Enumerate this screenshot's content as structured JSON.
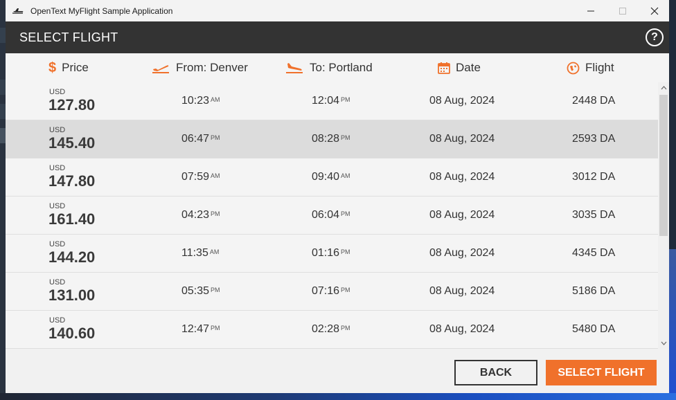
{
  "window": {
    "title": "OpenText MyFlight Sample Application"
  },
  "header": {
    "title": "SELECT FLIGHT",
    "help": "?"
  },
  "columns": {
    "price": "Price",
    "from": "From: Denver",
    "to": "To: Portland",
    "date": "Date",
    "flight": "Flight"
  },
  "flights": [
    {
      "currency": "USD",
      "price": "127.80",
      "dep_time": "10:23",
      "dep_ampm": "AM",
      "arr_time": "12:04",
      "arr_ampm": "PM",
      "date": "08 Aug, 2024",
      "flight": "2448 DA"
    },
    {
      "currency": "USD",
      "price": "145.40",
      "dep_time": "06:47",
      "dep_ampm": "PM",
      "arr_time": "08:28",
      "arr_ampm": "PM",
      "date": "08 Aug, 2024",
      "flight": "2593 DA"
    },
    {
      "currency": "USD",
      "price": "147.80",
      "dep_time": "07:59",
      "dep_ampm": "AM",
      "arr_time": "09:40",
      "arr_ampm": "AM",
      "date": "08 Aug, 2024",
      "flight": "3012 DA"
    },
    {
      "currency": "USD",
      "price": "161.40",
      "dep_time": "04:23",
      "dep_ampm": "PM",
      "arr_time": "06:04",
      "arr_ampm": "PM",
      "date": "08 Aug, 2024",
      "flight": "3035 DA"
    },
    {
      "currency": "USD",
      "price": "144.20",
      "dep_time": "11:35",
      "dep_ampm": "AM",
      "arr_time": "01:16",
      "arr_ampm": "PM",
      "date": "08 Aug, 2024",
      "flight": "4345 DA"
    },
    {
      "currency": "USD",
      "price": "131.00",
      "dep_time": "05:35",
      "dep_ampm": "PM",
      "arr_time": "07:16",
      "arr_ampm": "PM",
      "date": "08 Aug, 2024",
      "flight": "5186 DA"
    },
    {
      "currency": "USD",
      "price": "140.60",
      "dep_time": "12:47",
      "dep_ampm": "PM",
      "arr_time": "02:28",
      "arr_ampm": "PM",
      "date": "08 Aug, 2024",
      "flight": "5480 DA"
    }
  ],
  "buttons": {
    "back": "BACK",
    "select": "SELECT FLIGHT"
  },
  "colors": {
    "accent": "#f0712b",
    "header_bg": "#333333",
    "selected_row": "#dcdcdc"
  },
  "icons": {
    "app": "airplane-icon",
    "price": "dollar-icon",
    "from": "takeoff-icon",
    "to": "landing-icon",
    "date": "calendar-icon",
    "flight": "globe-icon"
  }
}
